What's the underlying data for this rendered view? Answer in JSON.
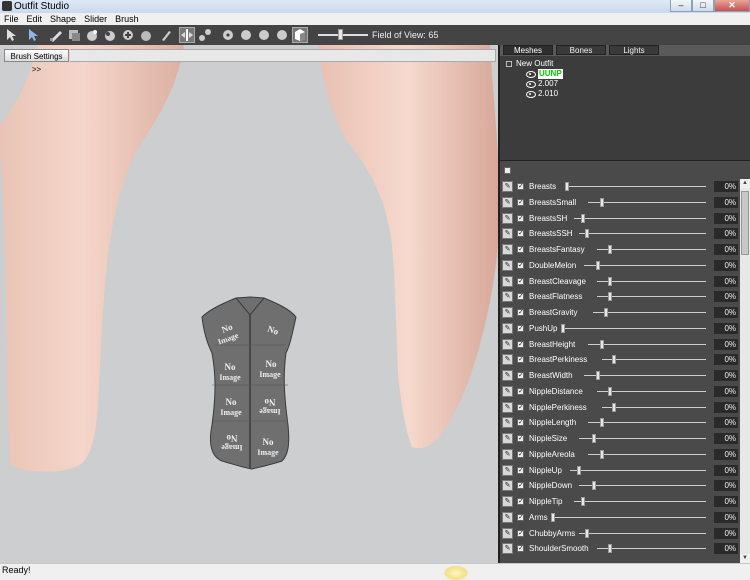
{
  "window": {
    "title": "Outfit Studio"
  },
  "menu": [
    "File",
    "Edit",
    "Shape",
    "Slider",
    "Brush"
  ],
  "toolbar": {
    "tools": [
      "select-brush-icon",
      "transform-brush-icon",
      "mask-brush-icon",
      "inflate-brush-icon",
      "deflate-brush-icon",
      "move-brush-icon",
      "smooth-brush-icon",
      "undiff-brush-icon",
      "weight-brush-icon",
      "color-brush-icon",
      "mirror-icon",
      "connect-icon",
      "view-front-icon",
      "view-left-icon",
      "view-back-icon",
      "view-right-icon",
      "perspective-icon"
    ],
    "fov_label": "Field of View: 65",
    "fov_value": 65
  },
  "viewport": {
    "brush_settings_label": "Brush Settings >>"
  },
  "tabs": [
    "Meshes",
    "Bones",
    "Lights"
  ],
  "active_tab": "Meshes",
  "tree": {
    "root": "New Outfit",
    "nodes": [
      "UUNP",
      "2.007",
      "2.010"
    ],
    "selected": "UUNP"
  },
  "sliders": [
    {
      "name": "Breasts",
      "value": "0%",
      "pos": 0.0
    },
    {
      "name": "BreastsSmall",
      "value": "0%",
      "pos": 0.1
    },
    {
      "name": "BreastsSH",
      "value": "0%",
      "pos": 0.05
    },
    {
      "name": "BreastsSSH",
      "value": "0%",
      "pos": 0.05
    },
    {
      "name": "BreastsFantasy",
      "value": "0%",
      "pos": 0.1
    },
    {
      "name": "DoubleMelon",
      "value": "0%",
      "pos": 0.1
    },
    {
      "name": "BreastCleavage",
      "value": "0%",
      "pos": 0.1
    },
    {
      "name": "BreastFlatness",
      "value": "0%",
      "pos": 0.1
    },
    {
      "name": "BreastGravity",
      "value": "0%",
      "pos": 0.1
    },
    {
      "name": "PushUp",
      "value": "0%",
      "pos": 0.0
    },
    {
      "name": "BreastHeight",
      "value": "0%",
      "pos": 0.1
    },
    {
      "name": "BreastPerkiness",
      "value": "0%",
      "pos": 0.1
    },
    {
      "name": "BreastWidth",
      "value": "0%",
      "pos": 0.1
    },
    {
      "name": "NippleDistance",
      "value": "0%",
      "pos": 0.1
    },
    {
      "name": "NipplePerkiness",
      "value": "0%",
      "pos": 0.1
    },
    {
      "name": "NippleLength",
      "value": "0%",
      "pos": 0.1
    },
    {
      "name": "NippleSize",
      "value": "0%",
      "pos": 0.1
    },
    {
      "name": "NippleAreola",
      "value": "0%",
      "pos": 0.1
    },
    {
      "name": "NippleUp",
      "value": "0%",
      "pos": 0.05
    },
    {
      "name": "NippleDown",
      "value": "0%",
      "pos": 0.1
    },
    {
      "name": "NippleTip",
      "value": "0%",
      "pos": 0.05
    },
    {
      "name": "Arms",
      "value": "0%",
      "pos": 0.0
    },
    {
      "name": "ChubbyArms",
      "value": "0%",
      "pos": 0.05
    },
    {
      "name": "ShoulderSmooth",
      "value": "0%",
      "pos": 0.1
    }
  ],
  "status": "Ready!",
  "colors": {
    "panel": "#4a4a4a",
    "viewport_bg": "#ccced0",
    "skin": "#f0cdbf",
    "selected_mesh": "#00cc00"
  }
}
